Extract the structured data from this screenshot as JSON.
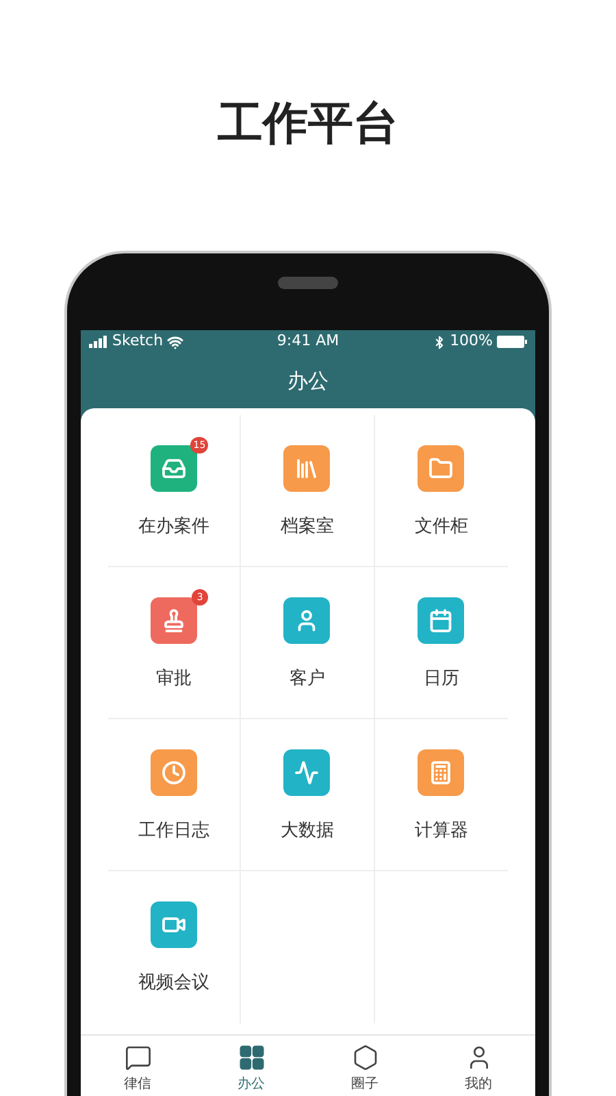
{
  "page_title": "工作平台",
  "status_bar": {
    "carrier": "Sketch",
    "time": "9:41 AM",
    "battery": "100%"
  },
  "header": {
    "title": "办公"
  },
  "apps": [
    {
      "label": "在办案件",
      "color": "#1fb27e",
      "badge": "15"
    },
    {
      "label": "档案室",
      "color": "#f79a4a"
    },
    {
      "label": "文件柜",
      "color": "#f79a4a"
    },
    {
      "label": "审批",
      "color": "#ef6a5e",
      "badge": "3"
    },
    {
      "label": "客户",
      "color": "#22b3c6"
    },
    {
      "label": "日历",
      "color": "#22b3c6"
    },
    {
      "label": "工作日志",
      "color": "#f79a4a"
    },
    {
      "label": "大数据",
      "color": "#22b3c6"
    },
    {
      "label": "计算器",
      "color": "#f79a4a"
    },
    {
      "label": "视频会议",
      "color": "#22b3c6"
    }
  ],
  "tab_bar": [
    {
      "label": "律信",
      "selected": false
    },
    {
      "label": "办公",
      "selected": true
    },
    {
      "label": "圈子",
      "selected": false
    },
    {
      "label": "我的",
      "selected": false
    }
  ]
}
